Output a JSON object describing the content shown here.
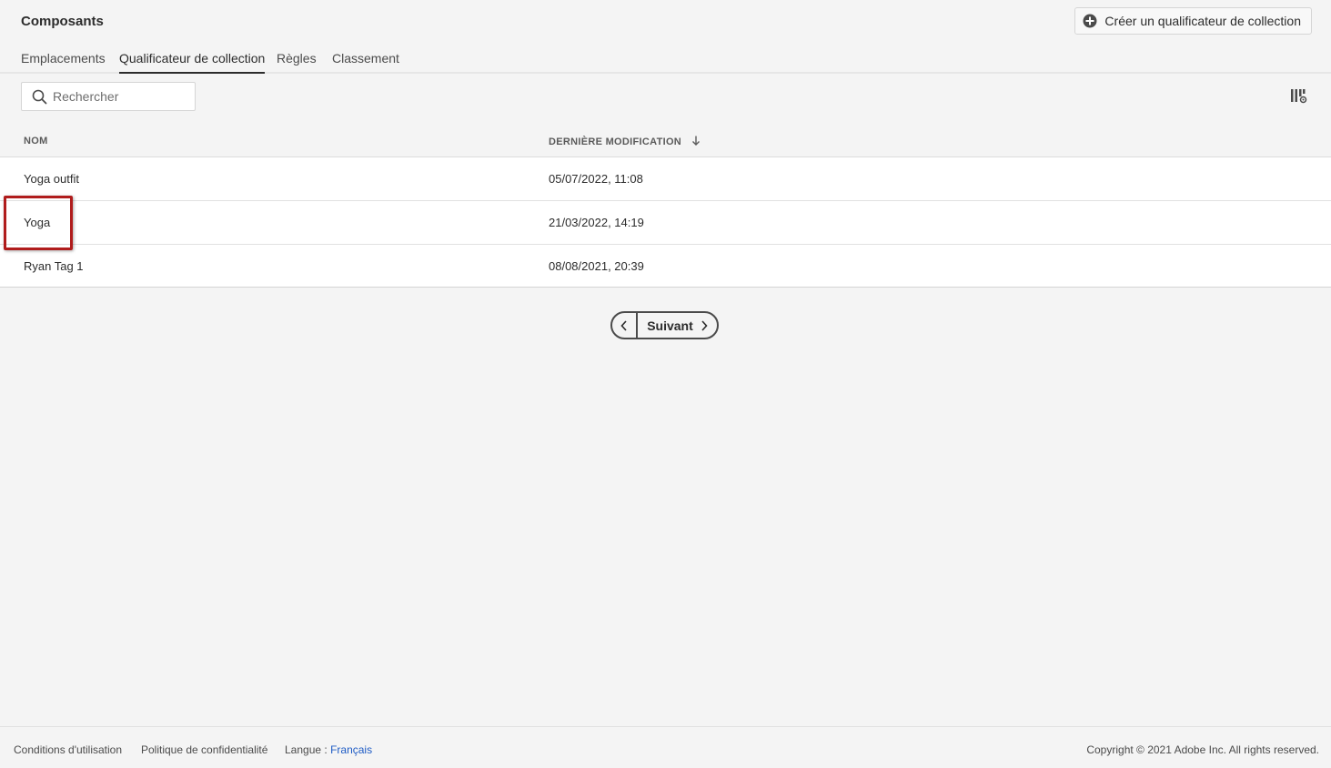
{
  "header": {
    "title": "Composants",
    "create_button_label": "Créer un qualificateur de collection"
  },
  "tabs": [
    {
      "label": "Emplacements",
      "active": false
    },
    {
      "label": "Qualificateur de collection",
      "active": true
    },
    {
      "label": "Règles",
      "active": false
    },
    {
      "label": "Classement",
      "active": false
    }
  ],
  "search": {
    "placeholder": "Rechercher",
    "value": ""
  },
  "table": {
    "columns": [
      "NOM",
      "DERNIÈRE MODIFICATION"
    ],
    "sort_column": "DERNIÈRE MODIFICATION",
    "sort_direction": "descending",
    "rows": [
      {
        "name": "Yoga outfit",
        "modified": "05/07/2022, 11:08"
      },
      {
        "name": "Yoga",
        "modified": "21/03/2022, 14:19"
      },
      {
        "name": "Ryan Tag 1",
        "modified": "08/08/2021, 20:39"
      }
    ]
  },
  "pagination": {
    "next_label": "Suivant"
  },
  "footer": {
    "terms": "Conditions d'utilisation",
    "privacy": "Politique de confidentialité",
    "language_label": "Langue :",
    "language_value": "Français",
    "copyright": "Copyright ©  2021 Adobe Inc.  All rights reserved."
  },
  "colors": {
    "highlight": "#b01c1c",
    "link": "#1f5cc5",
    "background": "#f4f4f4"
  },
  "icons": {
    "create": "plus-circle-icon",
    "search": "search-icon",
    "column_settings": "column-settings-icon",
    "sort": "arrow-down-icon",
    "prev": "chevron-left-icon",
    "next": "chevron-right-icon"
  }
}
